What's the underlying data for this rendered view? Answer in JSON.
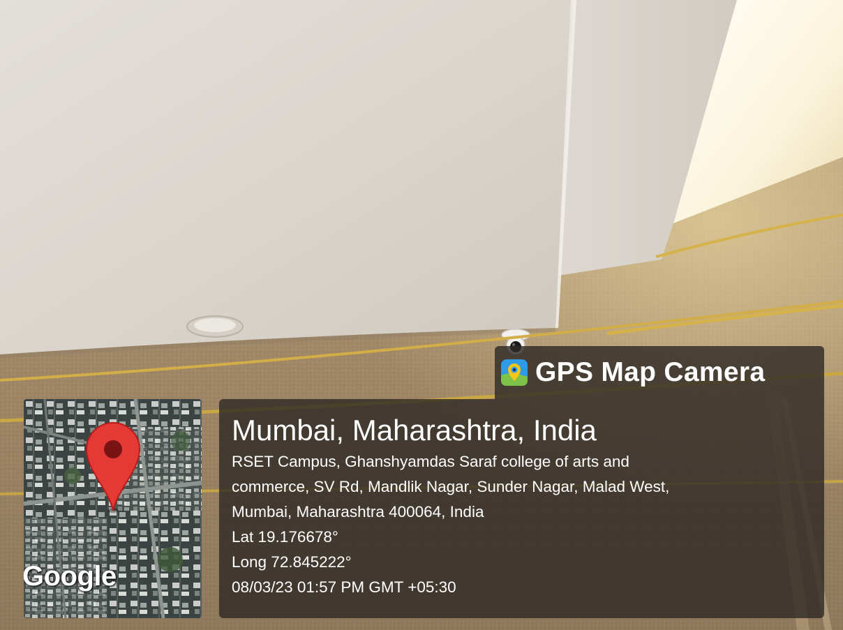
{
  "watermark": {
    "brand": "GPS Map Camera",
    "brand_icon": "gps-map-camera-app-icon"
  },
  "map": {
    "provider_mark": "Google",
    "marker_icon": "map-pin-icon",
    "marker_color": "#e53935"
  },
  "location": {
    "title": "Mumbai, Maharashtra, India",
    "address_lines": [
      "RSET Campus, Ghanshyamdas Saraf college of arts and",
      "commerce, SV Rd, Mandlik Nagar, Sunder Nagar, Malad West,",
      "Mumbai, Maharashtra 400064, India"
    ],
    "latitude": "Lat 19.176678°",
    "longitude": "Long 72.845222°",
    "timestamp": "08/03/23 01:57 PM GMT +05:30"
  },
  "colors": {
    "panel_background": "#2d2824",
    "panel_text": "#ffffff",
    "ceiling": "#dcd7d0",
    "wall_texture": "#a78e6c",
    "trim_lines": "#d6b24a"
  }
}
